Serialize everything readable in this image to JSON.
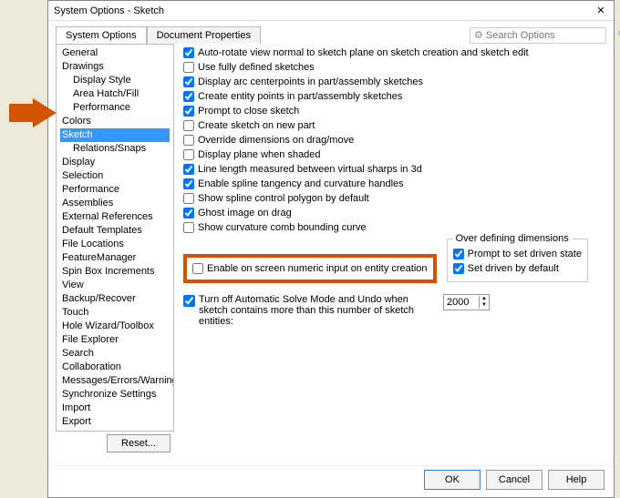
{
  "window": {
    "title": "System Options - Sketch",
    "close": "✕"
  },
  "search": {
    "placeholder": "Search Options"
  },
  "tabs": {
    "system_options": "System Options",
    "document_properties": "Document Properties"
  },
  "tree": {
    "items": [
      {
        "label": "General"
      },
      {
        "label": "Drawings",
        "children": [
          {
            "label": "Display Style"
          },
          {
            "label": "Area Hatch/Fill"
          },
          {
            "label": "Performance"
          }
        ]
      },
      {
        "label": "Colors"
      },
      {
        "label": "Sketch",
        "selected": true,
        "children": [
          {
            "label": "Relations/Snaps"
          }
        ]
      },
      {
        "label": "Display"
      },
      {
        "label": "Selection"
      },
      {
        "label": "Performance"
      },
      {
        "label": "Assemblies"
      },
      {
        "label": "External References"
      },
      {
        "label": "Default Templates"
      },
      {
        "label": "File Locations"
      },
      {
        "label": "FeatureManager"
      },
      {
        "label": "Spin Box Increments"
      },
      {
        "label": "View"
      },
      {
        "label": "Backup/Recover"
      },
      {
        "label": "Touch"
      },
      {
        "label": "Hole Wizard/Toolbox"
      },
      {
        "label": "File Explorer"
      },
      {
        "label": "Search"
      },
      {
        "label": "Collaboration"
      },
      {
        "label": "Messages/Errors/Warnings"
      },
      {
        "label": "Synchronize Settings"
      },
      {
        "label": "Import"
      },
      {
        "label": "Export"
      }
    ]
  },
  "options": [
    {
      "checked": true,
      "label": "Auto-rotate view normal to sketch plane on sketch creation and sketch edit"
    },
    {
      "checked": false,
      "label": "Use fully defined sketches"
    },
    {
      "checked": true,
      "label": "Display arc centerpoints in part/assembly sketches"
    },
    {
      "checked": true,
      "label": "Create entity points in part/assembly sketches"
    },
    {
      "checked": true,
      "label": "Prompt to close sketch"
    },
    {
      "checked": false,
      "label": "Create sketch on new part"
    },
    {
      "checked": false,
      "label": "Override dimensions on drag/move"
    },
    {
      "checked": false,
      "label": "Display plane when shaded"
    },
    {
      "checked": true,
      "label": "Line length measured between virtual sharps in 3d"
    },
    {
      "checked": true,
      "label": "Enable spline tangency and curvature handles"
    },
    {
      "checked": false,
      "label": "Show spline control polygon by default"
    },
    {
      "checked": true,
      "label": "Ghost image on drag"
    },
    {
      "checked": false,
      "label": "Show curvature comb bounding curve"
    }
  ],
  "highlighted_option": {
    "checked": false,
    "label": "Enable on screen numeric input on entity creation"
  },
  "over_defining": {
    "legend": "Over defining dimensions",
    "prompt": {
      "checked": true,
      "label": "Prompt to set driven state"
    },
    "driven": {
      "checked": true,
      "label": "Set driven by default"
    }
  },
  "autosolve": {
    "checked": true,
    "label": "Turn off Automatic Solve Mode and Undo when sketch contains more than this number of sketch entities:",
    "value": "2000"
  },
  "buttons": {
    "reset": "Reset...",
    "ok": "OK",
    "cancel": "Cancel",
    "help": "Help"
  }
}
